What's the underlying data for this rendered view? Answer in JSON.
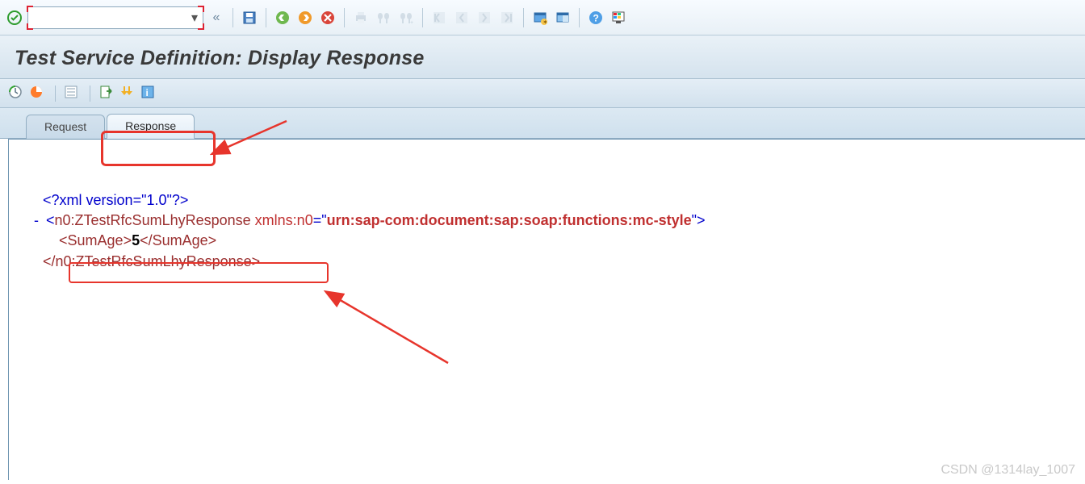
{
  "toolbar": {
    "cmd_value": "",
    "cmd_placeholder": ""
  },
  "title": "Test Service Definition: Display Response",
  "tabs": {
    "request": "Request",
    "response": "Response"
  },
  "xml": {
    "decl_open": "<?",
    "decl_name": "xml version=\"1.0\"",
    "decl_close": "?>",
    "minus": "-",
    "root_open_lt": "<",
    "root_name": "n0:ZTestRfcSumLhyResponse",
    "root_attr_name": "xmlns:n0",
    "root_attr_eq": "=\"",
    "root_attr_val": "urn:sap-com:document:sap:soap:functions:mc-style",
    "root_attr_close": "\">",
    "child_open": "<SumAge>",
    "child_text": "5",
    "child_close": "</SumAge>",
    "root_close": "</n0:ZTestRfcSumLhyResponse>"
  },
  "watermark": "CSDN @1314lay_1007"
}
